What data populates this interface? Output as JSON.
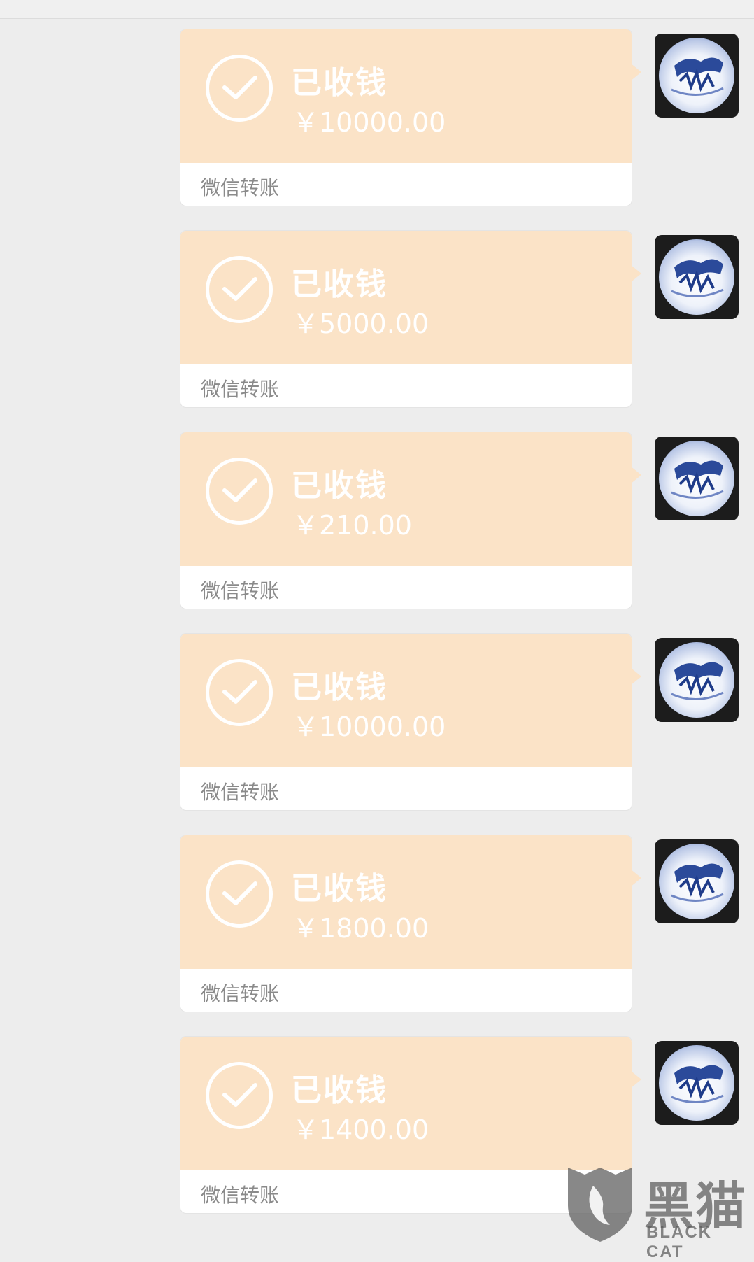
{
  "transfers": [
    {
      "status": "已收钱",
      "amount": "￥10000.00",
      "footer": "微信转账"
    },
    {
      "status": "已收钱",
      "amount": "￥5000.00",
      "footer": "微信转账"
    },
    {
      "status": "已收钱",
      "amount": "￥210.00",
      "footer": "微信转账"
    },
    {
      "status": "已收钱",
      "amount": "￥10000.00",
      "footer": "微信转账"
    },
    {
      "status": "已收钱",
      "amount": "￥1800.00",
      "footer": "微信转账"
    },
    {
      "status": "已收钱",
      "amount": "￥1400.00",
      "footer": "微信转账"
    }
  ],
  "icons": {
    "status": "check-circle-icon",
    "avatar": "blue-white-porcelain-plate"
  },
  "colors": {
    "background": "#ededed",
    "bubble_top": "#fbe3c7",
    "bubble_bottom": "#ffffff",
    "footer_text": "#8a8a8a",
    "status_text": "#ffffff"
  },
  "watermark": {
    "brand_cn": "黑猫",
    "brand_en": "BLACK CAT"
  }
}
